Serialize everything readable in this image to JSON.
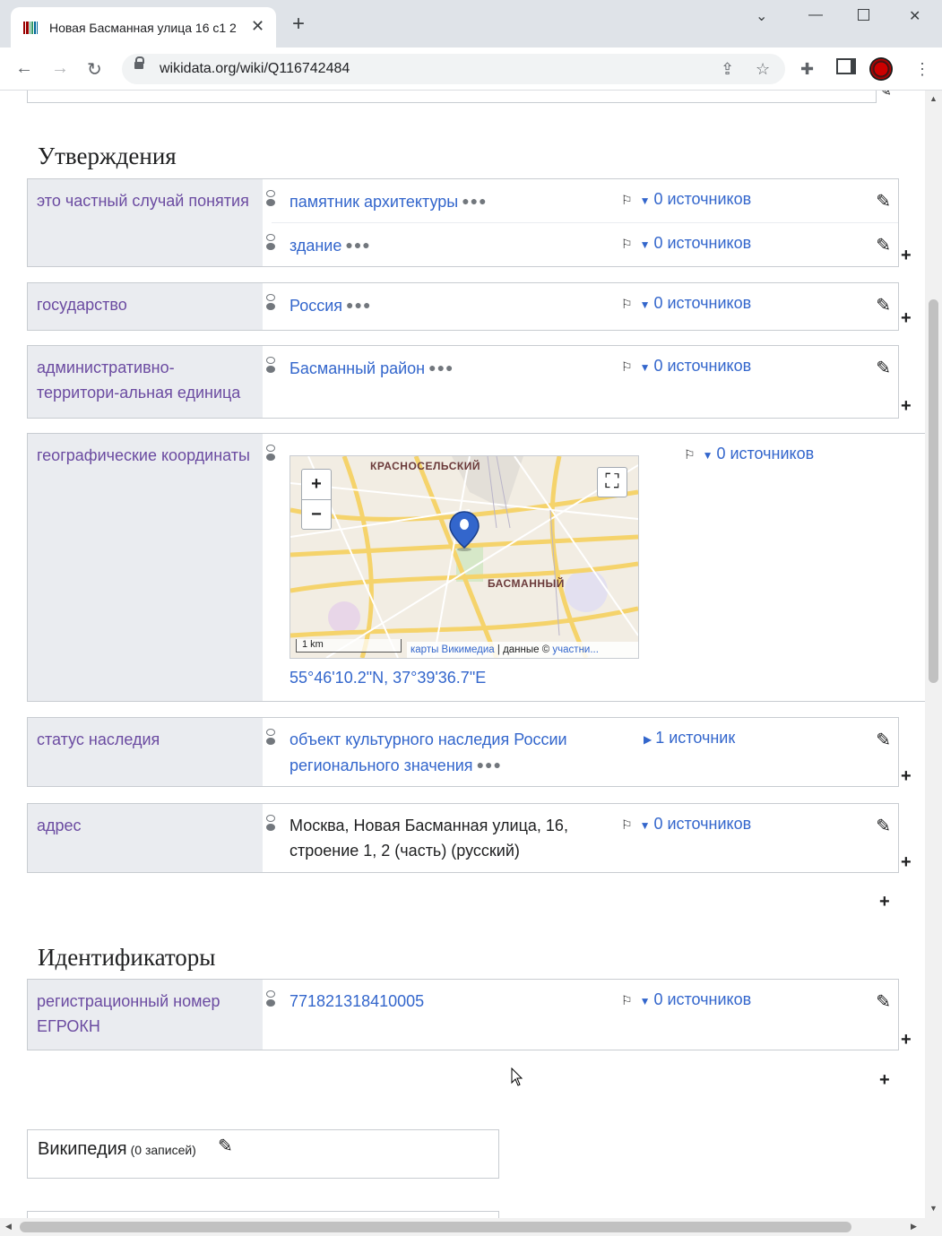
{
  "browser": {
    "tab_title": "Новая Басманная улица 16 с1 2",
    "url": "wikidata.org/wiki/Q116742484"
  },
  "sections": {
    "statements_title": "Утверждения",
    "identifiers_title": "Идентификаторы"
  },
  "statements": {
    "instance_of": {
      "property": "это частный случай понятия",
      "values": [
        {
          "value": "памятник архитектуры",
          "refs": "0 источников"
        },
        {
          "value": "здание",
          "refs": "0 источников"
        }
      ]
    },
    "country": {
      "property": "государство",
      "value": "Россия",
      "refs": "0 источников"
    },
    "admin": {
      "property": "административно-территори-альная единица",
      "value": "Басманный район",
      "refs": "0 источников"
    },
    "coords": {
      "property": "географические координаты",
      "refs": "0 источников",
      "value": "55°46'10.2\"N, 37°39'36.7\"E",
      "map": {
        "label_1": "КРАСНОСЕЛЬСКИЙ",
        "label_2": "БАСМАННЫЙ",
        "scale": "1 km",
        "attribution_link": "карты Викимедиа",
        "attribution_text": "| данные ©",
        "attribution_link2": "участни..."
      }
    },
    "heritage": {
      "property": "статус наследия",
      "value": "объект культурного наследия России регионального значения",
      "refs": "1 источник"
    },
    "address": {
      "property": "адрес",
      "value": "Москва, Новая Басманная улица, 16, строение 1, 2 (часть) (русский)",
      "refs": "0 источников"
    }
  },
  "identifiers": {
    "egrokn": {
      "property": "регистрационный номер ЕГРОКН",
      "value": "771821318410005",
      "refs": "0 источников"
    }
  },
  "wikipedia": {
    "title": "Википедия",
    "count": "(0 записей)"
  }
}
